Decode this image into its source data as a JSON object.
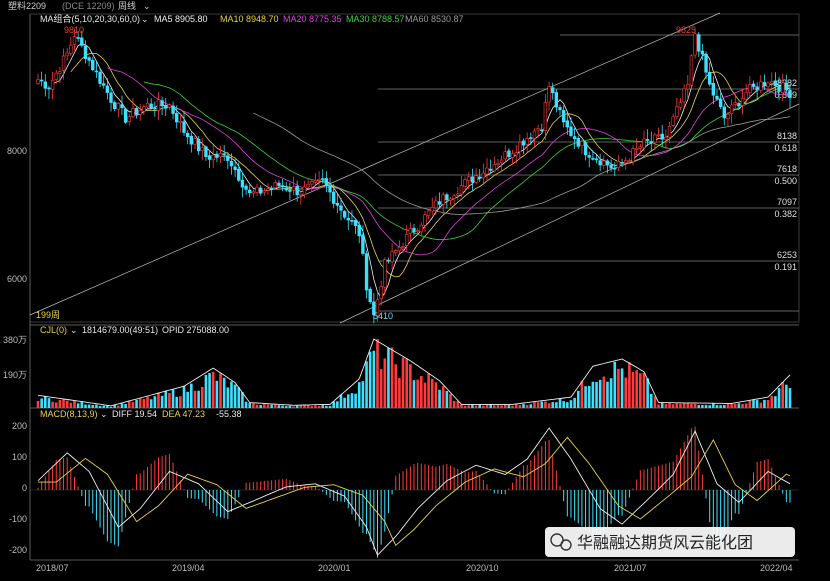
{
  "header": {
    "instrument": "塑料2209",
    "code": "(DCE 12209)",
    "period": "周线",
    "chevron": "⌄"
  },
  "ma_legend": [
    {
      "label": "MA组合(5,10,20,30,60,0)",
      "color": "#e8e8e8"
    },
    {
      "label": "MA5 8905.80",
      "color": "#f0f0f0"
    },
    {
      "label": "MA10 8948.70",
      "color": "#e8d34a"
    },
    {
      "label": "MA20 8775.35",
      "color": "#e040e0"
    },
    {
      "label": "MA30 8788.57",
      "color": "#3ad43a"
    },
    {
      "label": "MA60 8530.87",
      "color": "#9a9a9a"
    }
  ],
  "price_axis": {
    "labels": [
      "8000",
      "6000"
    ]
  },
  "annotations": {
    "high_2018": "9810",
    "low_2020": "5410",
    "high_2021": "9825",
    "cycle_label": "199周"
  },
  "fib_levels": [
    {
      "price": "8982",
      "ratio": "0.809"
    },
    {
      "price": "8138",
      "ratio": "0.618"
    },
    {
      "price": "7618",
      "ratio": "0.500"
    },
    {
      "price": "7097",
      "ratio": "0.382"
    },
    {
      "price": "6253",
      "ratio": "0.191"
    }
  ],
  "volume_panel": {
    "legend": "CJL(0)",
    "values": "1814679.00(49:51)",
    "opid": "OPID 275088.00",
    "axis": [
      "380万",
      "190万"
    ]
  },
  "macd_panel": {
    "legend": "MACD(8,13,9)",
    "diff": "DIFF 19.54",
    "dea": "DEA 47.23",
    "macd": "-55.38",
    "axis": [
      "200",
      "100",
      "0",
      "-100",
      "-200"
    ]
  },
  "time_axis": [
    "2018/07",
    "2019/04",
    "2020/01",
    "2020/10",
    "2021/07",
    "2022/04"
  ],
  "watermark": "华融融达期货风云能化团",
  "chart_data": {
    "type": "candlestick",
    "period": "weekly",
    "start_week": "2018/07",
    "end_week": "2022/04",
    "anchors": [
      {
        "week": 0,
        "price": 9100
      },
      {
        "week": 3,
        "price": 9000
      },
      {
        "week": 8,
        "price": 9500
      },
      {
        "week": 10,
        "price": 9810
      },
      {
        "week": 14,
        "price": 9400
      },
      {
        "week": 20,
        "price": 8800
      },
      {
        "week": 24,
        "price": 8500
      },
      {
        "week": 30,
        "price": 8700
      },
      {
        "week": 36,
        "price": 8700
      },
      {
        "week": 40,
        "price": 8300
      },
      {
        "week": 46,
        "price": 7900
      },
      {
        "week": 52,
        "price": 7900
      },
      {
        "week": 58,
        "price": 7300
      },
      {
        "week": 66,
        "price": 7450
      },
      {
        "week": 72,
        "price": 7350
      },
      {
        "week": 78,
        "price": 7500
      },
      {
        "week": 84,
        "price": 7000
      },
      {
        "week": 88,
        "price": 6700
      },
      {
        "week": 90,
        "price": 5900
      },
      {
        "week": 92,
        "price": 5410
      },
      {
        "week": 95,
        "price": 6200
      },
      {
        "week": 102,
        "price": 6700
      },
      {
        "week": 110,
        "price": 7200
      },
      {
        "week": 120,
        "price": 7600
      },
      {
        "week": 130,
        "price": 8000
      },
      {
        "week": 138,
        "price": 8400
      },
      {
        "week": 140,
        "price": 9000
      },
      {
        "week": 144,
        "price": 8400
      },
      {
        "week": 150,
        "price": 8000
      },
      {
        "week": 158,
        "price": 7700
      },
      {
        "week": 166,
        "price": 8100
      },
      {
        "week": 172,
        "price": 8200
      },
      {
        "week": 178,
        "price": 9000
      },
      {
        "week": 180,
        "price": 9825
      },
      {
        "week": 184,
        "price": 9000
      },
      {
        "week": 188,
        "price": 8500
      },
      {
        "week": 194,
        "price": 8900
      },
      {
        "week": 200,
        "price": 9100
      },
      {
        "week": 206,
        "price": 8900
      }
    ],
    "volume_peaks": [
      {
        "week": 0,
        "value": 70
      },
      {
        "week": 20,
        "value": 12
      },
      {
        "week": 40,
        "value": 120
      },
      {
        "week": 48,
        "value": 220
      },
      {
        "week": 54,
        "value": 140
      },
      {
        "week": 58,
        "value": 30
      },
      {
        "week": 70,
        "value": 15
      },
      {
        "week": 80,
        "value": 20
      },
      {
        "week": 88,
        "value": 160
      },
      {
        "week": 92,
        "value": 380
      },
      {
        "week": 102,
        "value": 260
      },
      {
        "week": 110,
        "value": 150
      },
      {
        "week": 116,
        "value": 20
      },
      {
        "week": 130,
        "value": 20
      },
      {
        "week": 146,
        "value": 60
      },
      {
        "week": 152,
        "value": 230
      },
      {
        "week": 160,
        "value": 270
      },
      {
        "week": 166,
        "value": 200
      },
      {
        "week": 170,
        "value": 30
      },
      {
        "week": 190,
        "value": 25
      },
      {
        "week": 200,
        "value": 60
      },
      {
        "week": 206,
        "value": 182
      }
    ],
    "macd_diff": [
      {
        "week": 0,
        "value": 30
      },
      {
        "week": 8,
        "value": 120
      },
      {
        "week": 14,
        "value": 60
      },
      {
        "week": 22,
        "value": -120
      },
      {
        "week": 28,
        "value": -60
      },
      {
        "week": 36,
        "value": 60
      },
      {
        "week": 44,
        "value": 20
      },
      {
        "week": 52,
        "value": -70
      },
      {
        "week": 60,
        "value": -30
      },
      {
        "week": 68,
        "value": 10
      },
      {
        "week": 76,
        "value": 20
      },
      {
        "week": 84,
        "value": -20
      },
      {
        "week": 90,
        "value": -120
      },
      {
        "week": 93,
        "value": -210
      },
      {
        "week": 98,
        "value": -150
      },
      {
        "week": 104,
        "value": -60
      },
      {
        "week": 112,
        "value": 30
      },
      {
        "week": 120,
        "value": 80
      },
      {
        "week": 128,
        "value": 50
      },
      {
        "week": 134,
        "value": 100
      },
      {
        "week": 140,
        "value": 200
      },
      {
        "week": 146,
        "value": 100
      },
      {
        "week": 154,
        "value": -60
      },
      {
        "week": 160,
        "value": -110
      },
      {
        "week": 168,
        "value": -20
      },
      {
        "week": 174,
        "value": 50
      },
      {
        "week": 180,
        "value": 190
      },
      {
        "week": 186,
        "value": 20
      },
      {
        "week": 192,
        "value": -40
      },
      {
        "week": 200,
        "value": 60
      },
      {
        "week": 206,
        "value": 20
      }
    ]
  }
}
